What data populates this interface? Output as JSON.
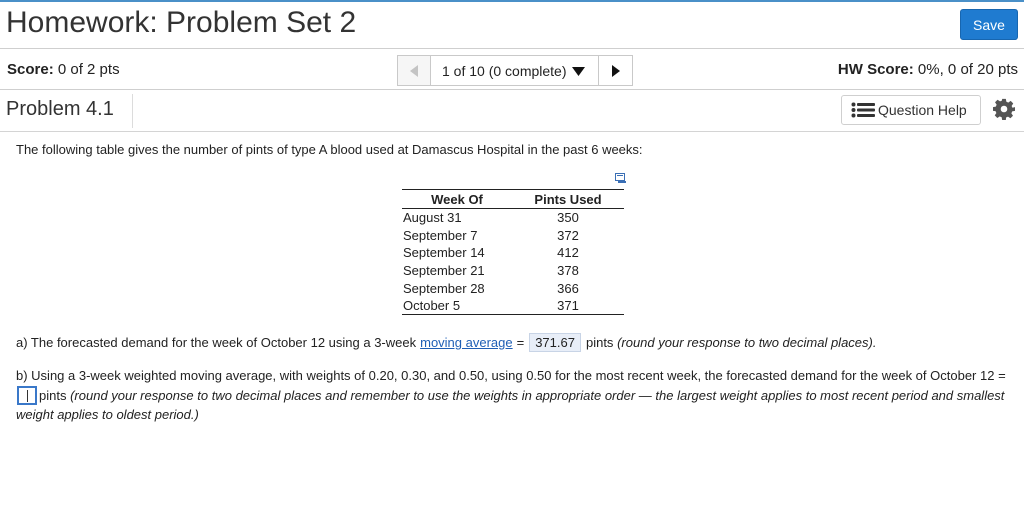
{
  "header": {
    "title": "Homework: Problem Set 2",
    "save_label": "Save"
  },
  "status": {
    "score_label": "Score:",
    "score_value": "0 of 2 pts",
    "nav_selected": "1 of 10 (0 complete)",
    "hw_score_label": "HW Score:",
    "hw_score_value": "0%, 0 of 20 pts"
  },
  "problem": {
    "title": "Problem 4.1",
    "question_help_label": "Question Help"
  },
  "question": {
    "intro": "The following table gives the number of pints of type A blood used at Damascus Hospital in the past 6 weeks:",
    "table": {
      "headers": [
        "Week Of",
        "Pints Used"
      ],
      "rows": [
        [
          "August 31",
          "350"
        ],
        [
          "September 7",
          "372"
        ],
        [
          "September 14",
          "412"
        ],
        [
          "September 21",
          "378"
        ],
        [
          "September 28",
          "366"
        ],
        [
          "October 5",
          "371"
        ]
      ]
    },
    "part_a": {
      "prefix": "a) The forecasted demand for the week of October 12 using a 3-week",
      "link": "moving average",
      "equals": "=",
      "answer": "371.67",
      "suffix": "pints",
      "hint": "(round your response to two decimal places)."
    },
    "part_b": {
      "prefix": "b) Using a 3-week weighted moving average, with weights of 0.20, 0.30, and 0.50, using 0.50 for the most recent week, the forecasted demand for the week of October 12 =",
      "suffix": "pints",
      "hint": "(round your response to two decimal places and remember to use the weights in appropriate order — the largest weight applies to most recent period and smallest weight applies to oldest period.)"
    }
  },
  "colors": {
    "accent": "#1f7bd0",
    "link": "#1f5fb5",
    "answer_bg": "#e8eef8"
  }
}
